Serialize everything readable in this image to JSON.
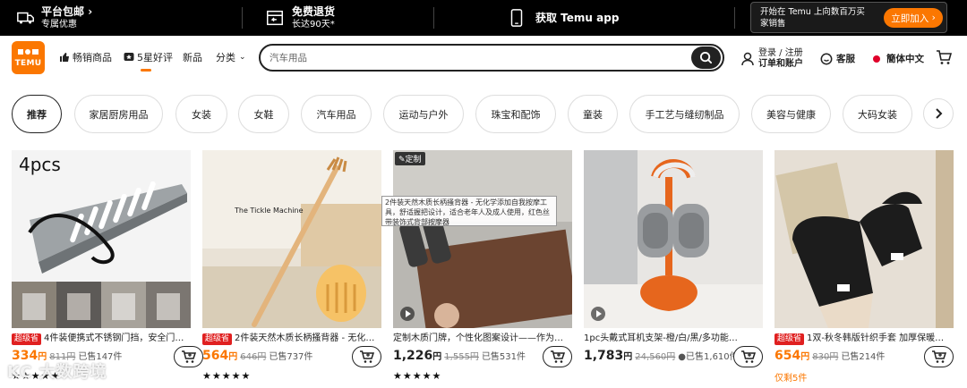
{
  "promo": {
    "shipping_title": "平台包邮",
    "shipping_sub": "专属优惠",
    "returns_title": "免费退货",
    "returns_sub": "长达90天*",
    "app_label": "获取 Temu app",
    "app_text": "开始在 Temu 上向数百万买家销售",
    "app_button": "立即加入"
  },
  "header": {
    "logo_text": "TEMU",
    "nav": [
      "畅销商品",
      "5星好评",
      "新品",
      "分类"
    ],
    "search_placeholder": "汽车用品",
    "login_line1": "登录 / 注册",
    "login_line2": "订单和账户",
    "service": "客服",
    "language": "簡体中文"
  },
  "categories": [
    "推荐",
    "家居厨房用品",
    "女装",
    "女鞋",
    "汽车用品",
    "运动与户外",
    "珠宝和配饰",
    "童装",
    "手工艺与缝纫制品",
    "美容与健康",
    "大码女装"
  ],
  "products": [
    {
      "image_text": "4pcs",
      "badge": "超级省",
      "title": "4件装便携式不锈钢门挡，安全门…",
      "price": "334",
      "currency": "円",
      "original": "811円",
      "sold": "已售147件",
      "stars": "★★★★★"
    },
    {
      "image_text": "The Tickle Machine",
      "badge": "超级省",
      "title": "2件装天然木质长柄搔背器 - 无化…",
      "price": "564",
      "currency": "円",
      "original": "646円",
      "sold": "已售737件",
      "stars": "★★★★★"
    },
    {
      "custom_tag": "定制",
      "title": "定制木质门牌，个性化图案设计——作为…",
      "price": "1,226",
      "currency": "円",
      "original": "1,555円",
      "sold": "已售531件",
      "stars": "★★★★★"
    },
    {
      "title": "1pc头戴式耳机支架-橙/白/黑/多功能…",
      "price": "1,783",
      "currency": "円",
      "original": "24,560円",
      "sold": "●已售1,610件",
      "stars": ""
    },
    {
      "badge": "超级省",
      "title": "1双-秋冬韩版针织手套 加厚保暖…",
      "price": "654",
      "currency": "円",
      "original": "830円",
      "sold": "已售214件",
      "remain": "仅剩5件"
    }
  ],
  "tooltip": "2件装天然木质长柄搔背器 - 无化学添加自我按摩工具，舒适握把设计，适合老年人及成人使用，红色丝带装饰式背部按摩器",
  "watermark": "KC 大数跨境"
}
